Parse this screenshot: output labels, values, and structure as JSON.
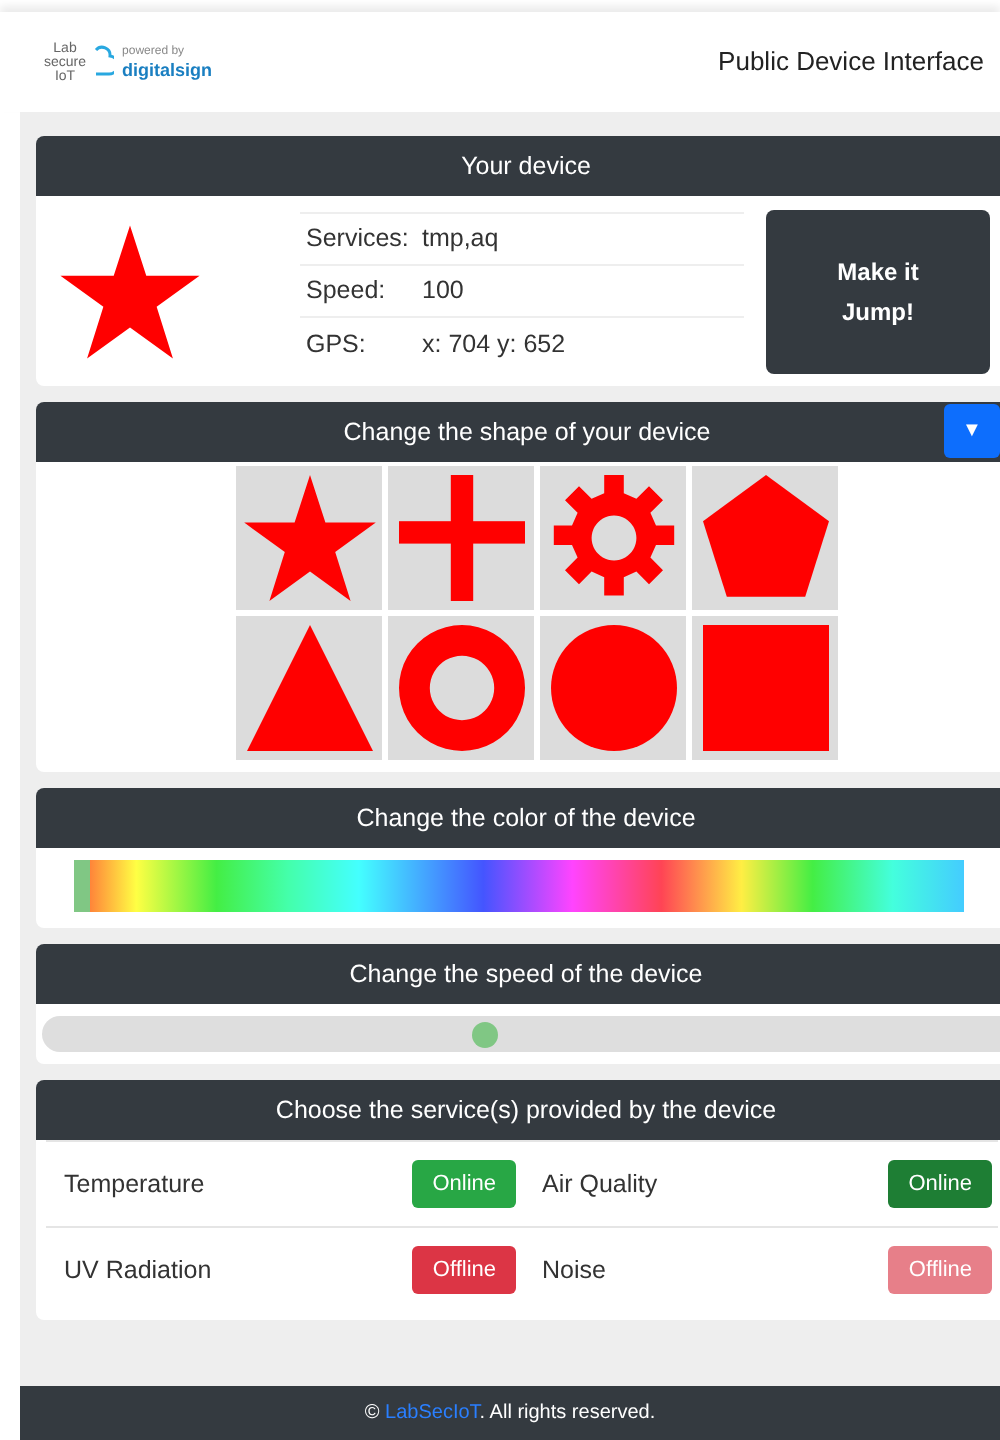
{
  "header": {
    "logo": {
      "line_1": "Lab",
      "line_2": "secure",
      "line_3": "IoT",
      "powered_by": "powered by",
      "brand": "digitalsign"
    },
    "title": "Public Device Interface"
  },
  "device": {
    "title": "Your device",
    "kind": "star",
    "color": "#ff0000",
    "info": [
      {
        "label": "Services:",
        "value": "tmp,aq"
      },
      {
        "label": "Speed:",
        "value": "100"
      },
      {
        "label": "GPS:",
        "value": "x: 704 y: 652"
      }
    ],
    "button": "Make it Jump!"
  },
  "shape_panel": {
    "title": "Change the shape of your device",
    "toggle": "▼",
    "shapes": [
      {
        "kind": "star"
      },
      {
        "kind": "cross"
      },
      {
        "kind": "gear"
      },
      {
        "kind": "pentagon"
      },
      {
        "kind": "triangle"
      },
      {
        "kind": "ring"
      },
      {
        "kind": "circle"
      },
      {
        "kind": "square"
      }
    ]
  },
  "color_panel": {
    "title": "Change the color of the device",
    "level": 0
  },
  "speed_panel": {
    "title": "Change the speed of the device",
    "level": 0.45
  },
  "services_panel": {
    "title": "Choose the service(s) provided by the device",
    "services": [
      {
        "name": "Temperature",
        "status": "Online",
        "color": "#28a745"
      },
      {
        "name": "Air Quality",
        "status": "Online",
        "color": "#1e7e34"
      },
      {
        "name": "UV Radiation",
        "status": "Offline",
        "color": "#dc3545"
      },
      {
        "name": "Noise",
        "status": "Offline",
        "color": "#e77f89"
      }
    ]
  },
  "footer": {
    "copyright": "©",
    "link": "LabSecIoT",
    "text": ". All rights reserved."
  }
}
